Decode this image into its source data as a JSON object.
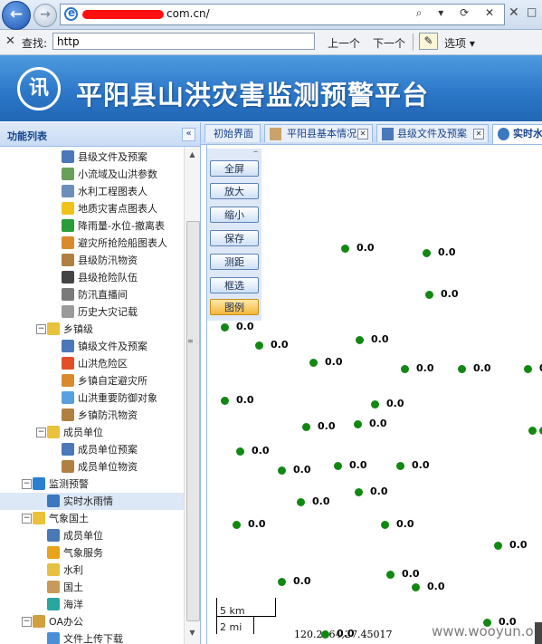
{
  "browser": {
    "url_visible": "com.cn/",
    "address_tools": "⌕ ▾ ⟳ ✕"
  },
  "find_bar": {
    "close": "✕",
    "label": "查找:",
    "value": "http",
    "prev": "上一个",
    "next": "下一个",
    "options": "选项 ▾"
  },
  "header": {
    "logo_text": "讯",
    "title": "平阳县山洪灾害监测预警平台"
  },
  "left_panel": {
    "title": "功能列表",
    "collapse": "«",
    "items": [
      {
        "label": "县级文件及预案",
        "color": "#4a78b8"
      },
      {
        "label": "小流域及山洪参数",
        "color": "#6a9f5a"
      },
      {
        "label": "水利工程图表人",
        "color": "#6c8fb9"
      },
      {
        "label": "地质灾害点图表人",
        "color": "#f1c21b"
      },
      {
        "label": "降雨量-水位-撤离表",
        "color": "#2a9d3a"
      },
      {
        "label": "避灾所抢险船图表人",
        "color": "#d98b2b"
      },
      {
        "label": "县级防汛物资",
        "color": "#b08040"
      },
      {
        "label": "县级抢险队伍",
        "color": "#444444"
      },
      {
        "label": "防汛直播间",
        "color": "#7a7a7a"
      },
      {
        "label": "历史大灾记载",
        "color": "#9a9a9a"
      },
      {
        "label": "乡镇级",
        "color": "#e9c13a"
      },
      {
        "label": "镇级文件及预案",
        "color": "#4a78b8"
      },
      {
        "label": "山洪危险区",
        "color": "#e34e2a"
      },
      {
        "label": "乡镇自定避灾所",
        "color": "#d98b2b"
      },
      {
        "label": "山洪重要防御对象",
        "color": "#5aa0e0"
      },
      {
        "label": "乡镇防汛物资",
        "color": "#b08040"
      },
      {
        "label": "成员单位",
        "color": "#e9c13a"
      },
      {
        "label": "成员单位预案",
        "color": "#4a78b8"
      },
      {
        "label": "成员单位物资",
        "color": "#b08040"
      },
      {
        "label": "监测预警",
        "color": "#2a7fd0"
      },
      {
        "label": "实时水雨情",
        "color": "#3a78c0"
      },
      {
        "label": "气象国土",
        "color": "#e9c13a"
      },
      {
        "label": "成员单位",
        "color": "#4a78b8"
      },
      {
        "label": "气象服务",
        "color": "#e9a21b"
      },
      {
        "label": "水利",
        "color": "#e8c040"
      },
      {
        "label": "国土",
        "color": "#c89a5a"
      },
      {
        "label": "海洋",
        "color": "#2aa6a0"
      },
      {
        "label": "OA办公",
        "color": "#d0a040"
      },
      {
        "label": "文件上传下载",
        "color": "#4a90d8"
      }
    ]
  },
  "tabs": [
    {
      "label": "初始界面"
    },
    {
      "label": "平阳县基本情况"
    },
    {
      "label": "县级文件及预案"
    },
    {
      "label": "实时水"
    }
  ],
  "map": {
    "tools": [
      "全屏",
      "放大",
      "缩小",
      "保存",
      "测距",
      "框选",
      "图例"
    ],
    "station_value": "0.0",
    "scale_km": "5 km",
    "scale_mi": "2 mi",
    "coordinates": "120.2964,27.45017",
    "watermark": "www.wooyun.org"
  }
}
